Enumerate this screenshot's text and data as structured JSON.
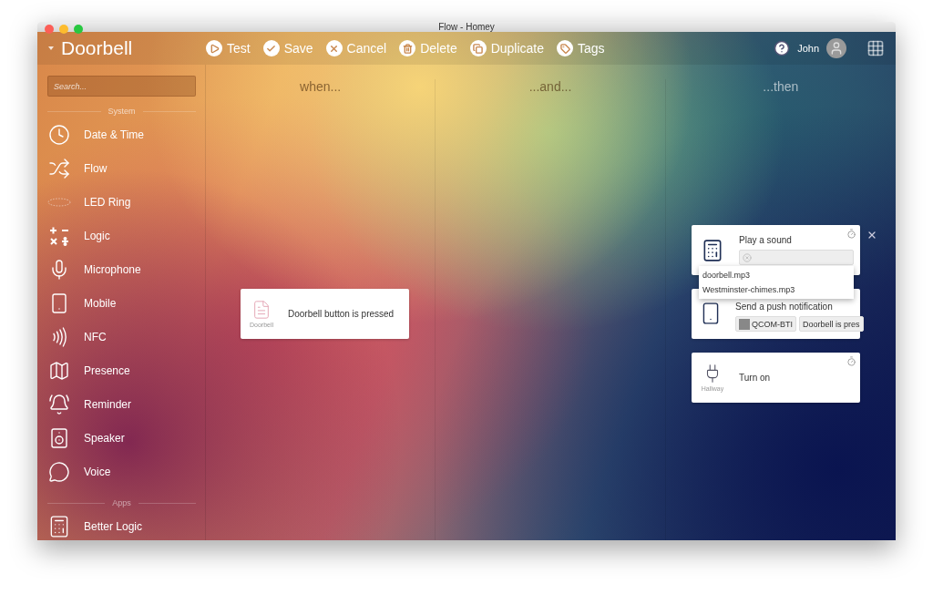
{
  "window": {
    "title": "Flow - Homey"
  },
  "sidebar": {
    "flow_name": "Doorbell",
    "search": {
      "placeholder": "Search..."
    },
    "sections": [
      {
        "label": "System",
        "items": [
          {
            "label": "Date & Time"
          },
          {
            "label": "Flow"
          },
          {
            "label": "LED Ring"
          },
          {
            "label": "Logic"
          },
          {
            "label": "Microphone"
          },
          {
            "label": "Mobile"
          },
          {
            "label": "NFC"
          },
          {
            "label": "Presence"
          },
          {
            "label": "Reminder"
          },
          {
            "label": "Speaker"
          },
          {
            "label": "Voice"
          }
        ]
      },
      {
        "label": "Apps",
        "items": [
          {
            "label": "Better Logic"
          }
        ]
      }
    ]
  },
  "toolbar": [
    "Test",
    "Save",
    "Cancel",
    "Delete",
    "Duplicate",
    "Tags"
  ],
  "user": {
    "name": "John"
  },
  "columns": [
    "when...",
    "...and...",
    "...then"
  ],
  "when_card": {
    "title": "Doorbell button is pressed",
    "device_label": "Doorbell"
  },
  "then_cards": [
    {
      "kind": "sound",
      "title": "Play a sound",
      "options": [
        "doorbell.mp3",
        "Westminster-chimes.mp3"
      ]
    },
    {
      "kind": "notification",
      "title": "Send a push notification",
      "tags": [
        "QCOM-BTI",
        "Doorbell is pres"
      ]
    },
    {
      "kind": "device",
      "title": "Turn on",
      "device_label": "Hallway"
    }
  ]
}
